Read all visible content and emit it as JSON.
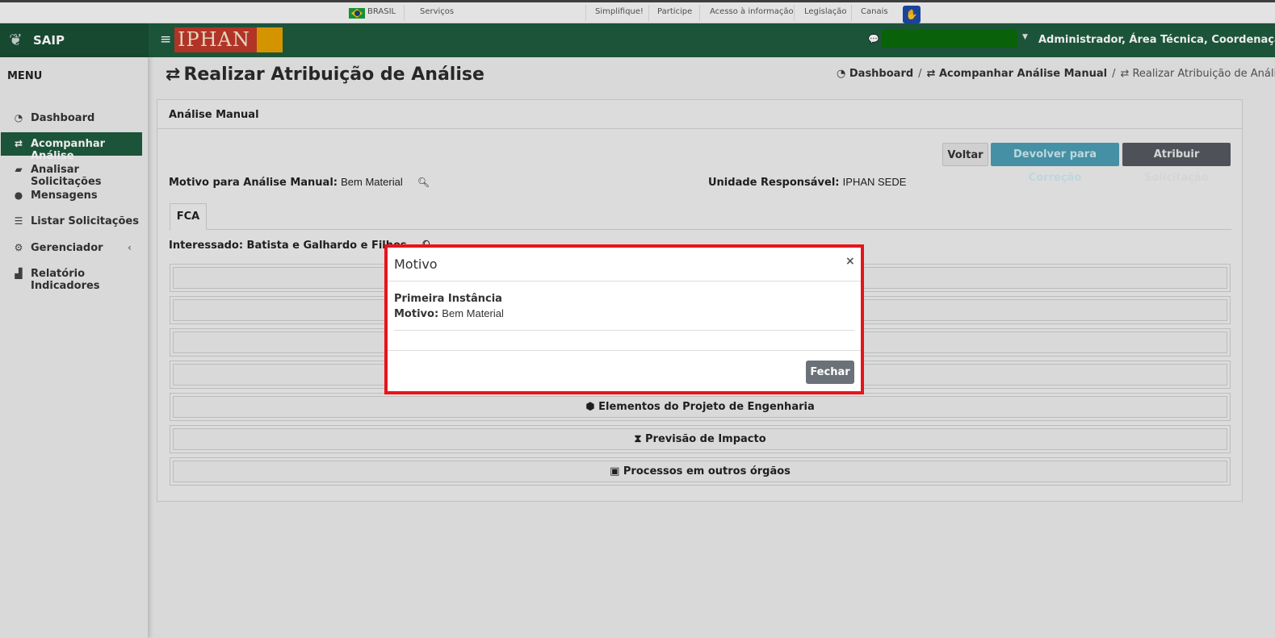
{
  "govbar": {
    "country": "BRASIL",
    "links": [
      "Serviços",
      "Simplifique!",
      "Participe",
      "Acesso à informação",
      "Legislação",
      "Canais"
    ]
  },
  "header": {
    "brand": "SAIP",
    "logo_text": "IPHAN",
    "user": "Administrador, Área Técnica, Coordenação..."
  },
  "sidebar": {
    "title": "MENU",
    "items": [
      {
        "label": "Dashboard",
        "icon": "dashboard-icon"
      },
      {
        "label": "Acompanhar Análise",
        "icon": "exchange-icon",
        "active": true
      },
      {
        "label": "Analisar Solicitações",
        "icon": "book-icon"
      },
      {
        "label": "Mensagens",
        "icon": "comments-icon"
      },
      {
        "label": "Listar Solicitações",
        "icon": "list-icon"
      },
      {
        "label": "Gerenciador",
        "icon": "cogs-icon"
      },
      {
        "label": "Relatório Indicadores",
        "icon": "area-chart-icon"
      }
    ]
  },
  "page": {
    "title": "Realizar Atribuição de Análise",
    "breadcrumb": [
      "Dashboard",
      "Acompanhar Análise Manual",
      "Realizar Atribuição de Análise"
    ]
  },
  "card": {
    "title": "Análise Manual",
    "buttons": {
      "voltar": "Voltar",
      "devolver": "Devolver para Correção",
      "atribuir": "Atribuir Solicitação"
    },
    "motivo_label": "Motivo para Análise Manual:",
    "motivo_value": "Bem Material",
    "unidade_label": "Unidade Responsável:",
    "unidade_value": "IPHAN SEDE",
    "tab": "FCA",
    "interessado": "Interessado: Batista e Galhardo e Filhos",
    "sections": [
      "",
      "",
      "",
      "",
      "Elementos do Projeto de Engenharia",
      "Previsão de Impacto",
      "Processos em outros órgãos"
    ]
  },
  "modal": {
    "title": "Motivo",
    "close": "×",
    "instance": "Primeira Instância",
    "motivo_label": "Motivo:",
    "motivo_value": "Bem Material",
    "button": "Fechar"
  },
  "colors": {
    "header_green": "#1f5c3e",
    "modal_border": "#e8141b",
    "info_button": "#4b9db2",
    "dark_button": "#555a60"
  }
}
